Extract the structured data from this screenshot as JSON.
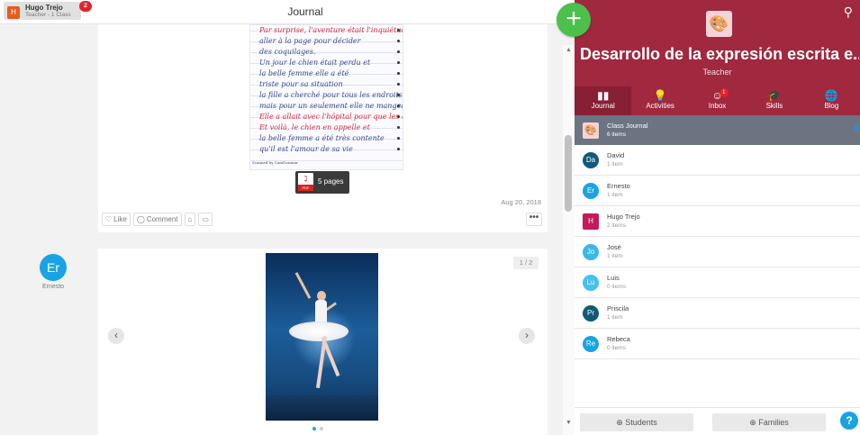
{
  "topbar": {
    "user_initial": "H",
    "user_name": "Hugo Trejo",
    "user_role": "Teacher - 1 Class",
    "notification_count": "2",
    "page_title": "Journal"
  },
  "view_toggle": {
    "list_icon": "list-view-icon",
    "grid_icon": "grid-view-icon"
  },
  "post1": {
    "handwriting_lines": [
      "Par surprise, l'aventure était l'inquiétude",
      "aller à la page pour décider",
      "des coquilages.",
      "Un jour le chien était perdu et",
      "la belle femme elle a été",
      "triste pour sa situation",
      "la fille a cherché pour tous les endroits",
      "mais pour un seulement elle ne mangeait pas",
      "Elle a allait avec l'hôpital pour que les activités",
      "Et voilà, le chien en appelle et",
      "la belle femme a été très contente",
      "qu'il est l'amour de sa vie"
    ],
    "scanner_note": "Scanned by CamScanner",
    "pdf_label": "PDF",
    "pdf_pages": "5 pages",
    "date": "Aug 20, 2018",
    "actions": {
      "like": "Like",
      "comment": "Comment"
    },
    "more": "•••"
  },
  "post2": {
    "author_initials": "Er",
    "author_name": "Ernesto",
    "counter": "1 / 2",
    "prev_arrow": "‹",
    "next_arrow": "›"
  },
  "add_button": "+",
  "panel": {
    "class_icon": "🎨",
    "class_title": "Desarrollo de la expresión escrita e...",
    "role": "Teacher",
    "tabs": [
      {
        "label": "Journal",
        "icon": "▮▮"
      },
      {
        "label": "Activities",
        "icon": "💡"
      },
      {
        "label": "Inbox",
        "icon": "☺",
        "badge": "1"
      },
      {
        "label": "Skills",
        "icon": "🎓"
      },
      {
        "label": "Blog",
        "icon": "🌐"
      }
    ],
    "list": [
      {
        "initials": "🎨",
        "name": "Class Journal",
        "count": "6 items",
        "color": "#f4d3d7"
      },
      {
        "initials": "Da",
        "name": "David",
        "count": "1 item",
        "color": "#0f5a78"
      },
      {
        "initials": "Er",
        "name": "Ernesto",
        "count": "1 item",
        "color": "#1aa3e3"
      },
      {
        "initials": "H",
        "name": "Hugo Trejo",
        "count": "2 items",
        "color": "#c41a5b"
      },
      {
        "initials": "Jo",
        "name": "José",
        "count": "1 item",
        "color": "#3bb8e8"
      },
      {
        "initials": "Lu",
        "name": "Luis",
        "count": "0 items",
        "color": "#43c1ef"
      },
      {
        "initials": "Pr",
        "name": "Priscila",
        "count": "1 item",
        "color": "#0f5a78"
      },
      {
        "initials": "Re",
        "name": "Rebeca",
        "count": "0 items",
        "color": "#1aa3e3"
      }
    ],
    "students_btn": "⊕ Students",
    "families_btn": "⊕ Families",
    "help": "?"
  }
}
